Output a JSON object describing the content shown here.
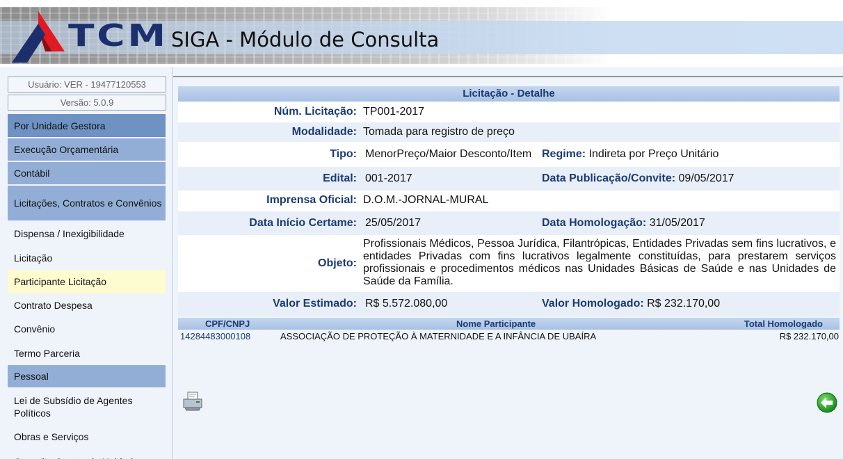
{
  "header": {
    "logo_text": "TCM",
    "title": "SIGA - Módulo de Consulta",
    "colors": {
      "logo_red": "#e21a22",
      "logo_navy": "#1c2f6c"
    }
  },
  "sidebar": {
    "user": "Usuário: VER - 19477120553",
    "version": "Versão: 5.0.9",
    "items": [
      {
        "label": "Por Unidade Gestora",
        "kind": "category-active"
      },
      {
        "label": "Execução Orçamentária",
        "kind": "category"
      },
      {
        "label": "Contábil",
        "kind": "category"
      },
      {
        "label": "Licitações, Contratos e Convênios",
        "kind": "category"
      },
      {
        "label": "Dispensa / Inexigibilidade",
        "kind": "sub"
      },
      {
        "label": "Licitação",
        "kind": "sub"
      },
      {
        "label": "Participante Licitação",
        "kind": "sub-selected"
      },
      {
        "label": "Contrato Despesa",
        "kind": "sub"
      },
      {
        "label": "Convênio",
        "kind": "sub"
      },
      {
        "label": "Termo Parceria",
        "kind": "sub"
      },
      {
        "label": "Pessoal",
        "kind": "category"
      },
      {
        "label": "Lei de Subsídio de Agentes Políticos",
        "kind": "sub"
      },
      {
        "label": "Obras e Serviços",
        "kind": "sub"
      },
      {
        "label": "Consulta Contas de Unidad",
        "kind": "sub"
      }
    ]
  },
  "detail": {
    "title": "Licitação - Detalhe",
    "num_label": "Núm. Licitação:",
    "num_value": "TP001-2017",
    "modalidade_label": "Modalidade:",
    "modalidade_value": "Tomada para registro de preço",
    "tipo_label": "Tipo:",
    "tipo_value": "MenorPreço/Maior Desconto/Item",
    "regime_label": "Regime:",
    "regime_value": "Indireta por Preço Unitário",
    "edital_label": "Edital:",
    "edital_value": "001-2017",
    "data_pub_label": "Data Publicação/Convite:",
    "data_pub_value": "09/05/2017",
    "imprensa_label": "Imprensa Oficial:",
    "imprensa_value": "D.O.M.-JORNAL-MURAL",
    "data_inicio_label": "Data Início Certame:",
    "data_inicio_value": "25/05/2017",
    "data_homol_label": "Data Homologação:",
    "data_homol_value": "31/05/2017",
    "objeto_label": "Objeto:",
    "objeto_value": "Profissionais Médicos, Pessoa Jurídica, Filantrópicas, Entidades Privadas sem fins lucrativos, e entidades Privadas com fins lucrativos legalmente constituídas, para prestarem serviços profissionais e procedimentos médicos nas Unidades Básicas de Saúde e nas Unidades de Saúde da Família.",
    "valor_est_label": "Valor Estimado:",
    "valor_est_value": "R$ 5.572.080,00",
    "valor_homol_label": "Valor Homologado:",
    "valor_homol_value": "R$ 232.170,00"
  },
  "participants": {
    "columns": [
      "CPF/CNPJ",
      "Nome Participante",
      "Total Homologado"
    ],
    "rows": [
      {
        "cpf_cnpj": "14284483000108",
        "nome": "ASSOCIAÇÃO DE PROTEÇÃO À MATERNIDADE E A INFÂNCIA DE UBAÍRA",
        "total": "R$ 232.170,00"
      }
    ]
  },
  "icons": {
    "print": "printer-icon",
    "back": "back-arrow-icon"
  }
}
